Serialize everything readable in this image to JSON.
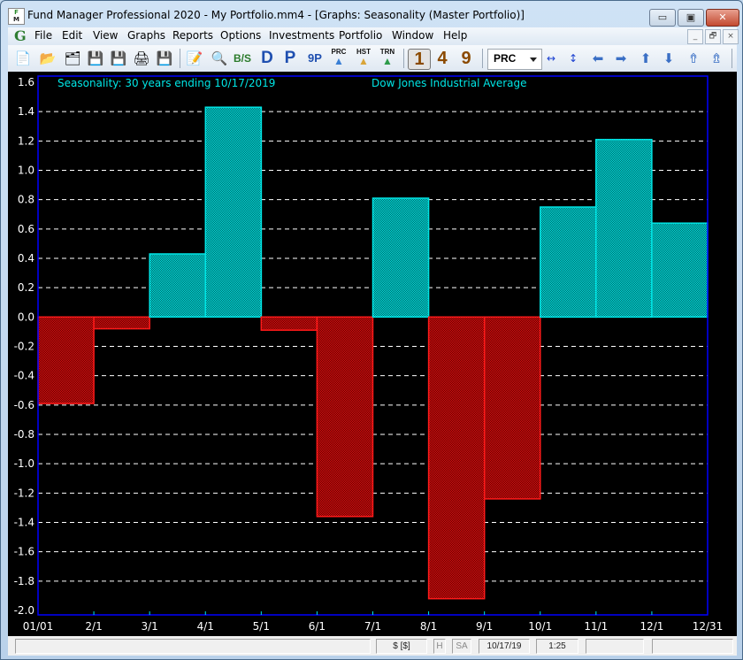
{
  "window": {
    "title": "Fund Manager Professional 2020 - My Portfolio.mm4 - [Graphs: Seasonality (Master Portfolio)]",
    "icon_top": "F",
    "icon_bottom": "M",
    "min_glyph": "▭",
    "max_glyph": "▣",
    "close_glyph": "✕"
  },
  "menubar": {
    "logo": "G",
    "items": [
      "File",
      "Edit",
      "View",
      "Graphs",
      "Reports",
      "Options",
      "Investments",
      "Portfolio",
      "Window",
      "Help"
    ],
    "mdi_min": "_",
    "mdi_restore": "🗗",
    "mdi_close": "×"
  },
  "toolbar": {
    "new_icon": "📄",
    "open_icon": "📂",
    "open_multi_icon": "🗂",
    "save_icon": "💾",
    "save_all_icon": "💾",
    "print_icon": "🖨",
    "import_icon": "💾",
    "edit_icon": "📝",
    "find_icon": "🔍",
    "bs_label": "B/S",
    "d_label": "D",
    "p_label": "P",
    "ninep_label": "9P",
    "prc_label": "PRC",
    "hst_label": "HST",
    "trn_label": "TRN",
    "num1": "1",
    "num4": "4",
    "num9": "9",
    "combo_value": "PRC",
    "arrow_left": "⬅",
    "arrow_right": "➡",
    "arrow_up": "⬆",
    "arrow_down": "⬇",
    "arrow_up_fast": "⇮",
    "arrow_down_fast": "⇯",
    "colors": {
      "prc": "#3a7fd5",
      "hst": "#d9a53a",
      "trn": "#2e9b4a",
      "num": "#8b4a00"
    }
  },
  "status": {
    "message": "",
    "currency": "$ [$]",
    "h": "H",
    "sa": "SA",
    "date": "10/17/19",
    "time": "1:25",
    "extra1": "",
    "extra2": ""
  },
  "chart_data": {
    "type": "bar",
    "title": "Seasonality: 30 years ending 10/17/2019",
    "subtitle": "Dow Jones Industrial Average",
    "xlabel": "",
    "ylabel": "",
    "x_tick_labels": [
      "01/01",
      "2/1",
      "3/1",
      "4/1",
      "5/1",
      "6/1",
      "7/1",
      "8/1",
      "9/1",
      "10/1",
      "11/1",
      "12/1",
      "12/31"
    ],
    "categories": [
      "Jan",
      "Feb",
      "Mar",
      "Apr",
      "May",
      "Jun",
      "Jul",
      "Aug",
      "Sep",
      "Oct",
      "Nov",
      "Dec"
    ],
    "values": [
      -0.59,
      -0.08,
      0.43,
      1.43,
      -0.09,
      -1.36,
      0.81,
      -1.92,
      -1.24,
      0.75,
      1.21,
      0.64
    ],
    "ylim": [
      -2.0,
      1.6
    ],
    "y_ticks": [
      1.6,
      1.4,
      1.2,
      1.0,
      0.8,
      0.6,
      0.4,
      0.2,
      0.0,
      -0.2,
      -0.4,
      -0.6,
      -0.8,
      -1.0,
      -1.2,
      -1.4,
      -1.6,
      -1.8,
      -2.0
    ],
    "y_tick_labels": [
      "1.6",
      "1.4",
      "1.2",
      "1.0",
      "0.8",
      "0.6",
      "0.4",
      "0.2",
      "0.0",
      "-0.2",
      "-0.4",
      "-0.6",
      "-0.8",
      "-1.0",
      "-1.2",
      "-1.4",
      "-1.6",
      "-1.8",
      "-2.0"
    ],
    "grid": true,
    "colors": {
      "positive": "#00e5e5",
      "negative": "#ff1a1a",
      "background": "#000000",
      "frame": "#0000ff",
      "grid": "#ffffff",
      "text": "#ffffff",
      "title": "#00e5e5"
    }
  }
}
